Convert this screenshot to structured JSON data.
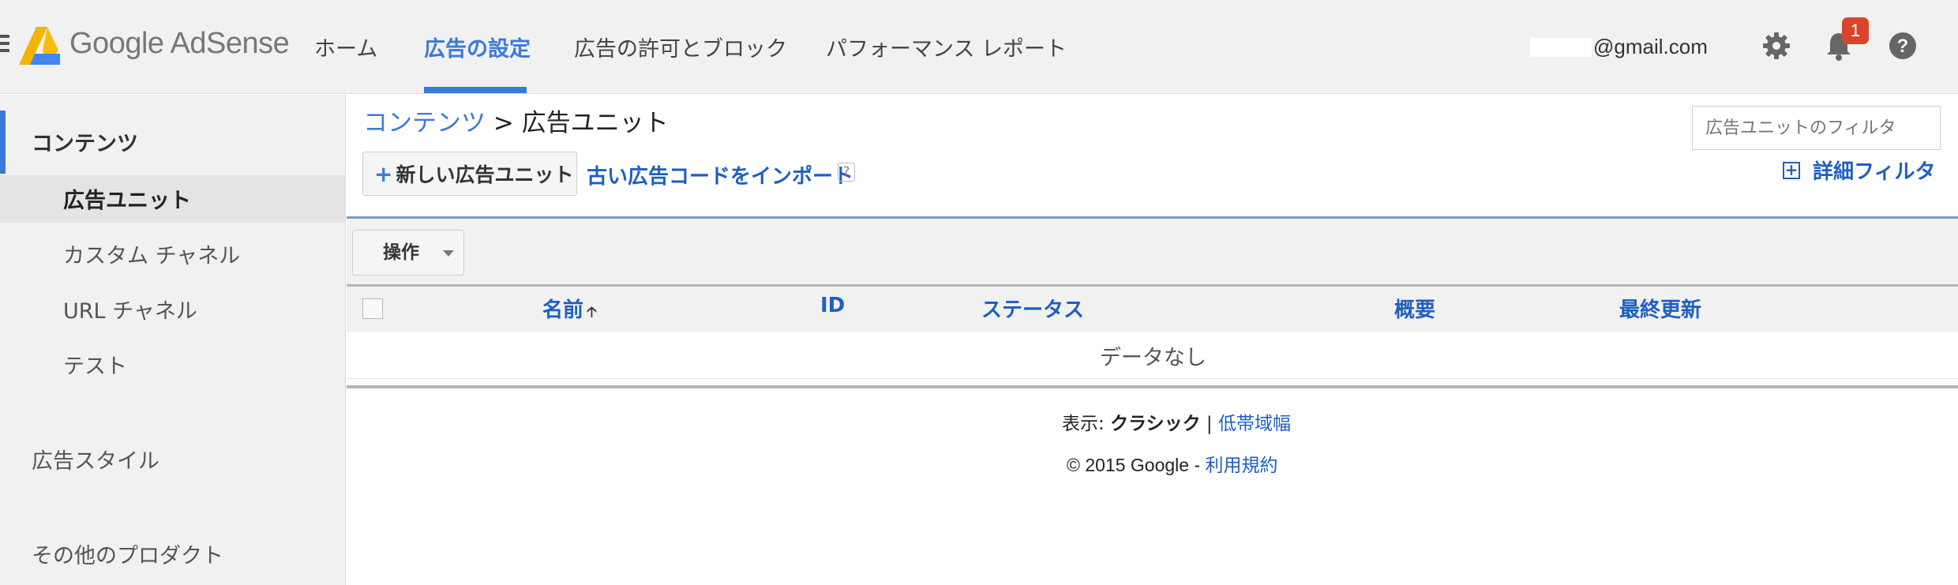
{
  "header": {
    "app_name": "Google AdSense",
    "tabs": [
      {
        "label": "ホーム",
        "active": false
      },
      {
        "label": "広告の設定",
        "active": true
      },
      {
        "label": "広告の許可とブロック",
        "active": false
      },
      {
        "label": "パフォーマンス レポート",
        "active": false
      }
    ],
    "account_email": "@gmail.com",
    "notification_count": "1",
    "icons": [
      "menu-icon",
      "adsense-logo",
      "gear-icon",
      "bell-icon",
      "help-icon"
    ],
    "accent_color": "#3b7ad9",
    "badge_color": "#d9452c"
  },
  "sidebar": {
    "section": "コンテンツ",
    "items": [
      {
        "label": "広告ユニット",
        "selected": true
      },
      {
        "label": "カスタム チャネル",
        "selected": false
      },
      {
        "label": "URL チャネル",
        "selected": false
      },
      {
        "label": "テスト",
        "selected": false
      }
    ],
    "ad_styles": "広告スタイル",
    "other_products": "その他のプロダクト"
  },
  "main": {
    "breadcrumb": {
      "parent": "コンテンツ",
      "separator": ">",
      "current": "広告ユニット"
    },
    "new_unit_button": "新しい広告ユニット",
    "import_link": "古い広告コードをインポート",
    "help_mark": "?",
    "filter_placeholder": "広告ユニットのフィルタ",
    "advanced_filter": "詳細フィルタ",
    "operations_button": "操作",
    "table": {
      "columns": [
        "名前",
        "ID",
        "ステータス",
        "概要",
        "最終更新"
      ],
      "sorted_column": "名前",
      "sort_direction": "ascending",
      "empty_message": "データなし"
    }
  },
  "footer": {
    "view_label": "表示:",
    "view_current": "クラシック",
    "view_separator": "|",
    "view_alternative": "低帯域幅",
    "copyright": "© 2015 Google -",
    "terms_link": "利用規約"
  }
}
